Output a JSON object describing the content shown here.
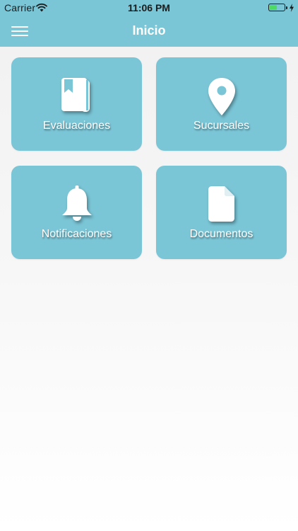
{
  "status_bar": {
    "carrier": "Carrier",
    "time": "11:06 PM",
    "battery_level": 0.55,
    "icons": [
      "wifi-icon",
      "battery-icon",
      "charging-bolt-icon"
    ]
  },
  "nav": {
    "title": "Inicio",
    "menu_icon": "hamburger-menu-icon"
  },
  "tiles": [
    {
      "label": "Evaluaciones",
      "icon": "book-icon"
    },
    {
      "label": "Sucursales",
      "icon": "map-pin-icon"
    },
    {
      "label": "Notificaciones",
      "icon": "bell-icon"
    },
    {
      "label": "Documentos",
      "icon": "document-icon"
    }
  ],
  "colors": {
    "accent": "#7ac5d6",
    "tile_text": "#ffffff",
    "battery_fill": "#4cd964"
  }
}
